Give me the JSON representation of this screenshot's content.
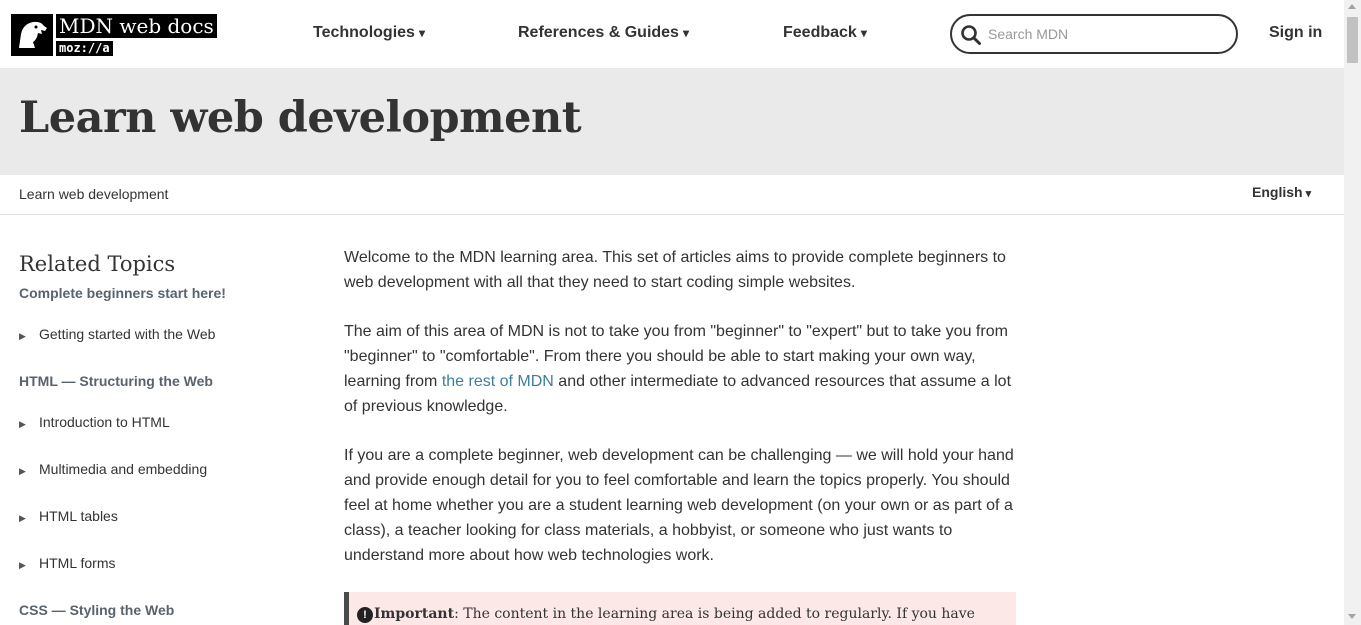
{
  "header": {
    "logo_title": "MDN web docs",
    "logo_sub": "moz://a",
    "logo_icon": "dinosaur-head-icon",
    "nav": [
      {
        "label": "Technologies"
      },
      {
        "label": "References & Guides"
      },
      {
        "label": "Feedback"
      }
    ],
    "nav_caret": "▾",
    "search_placeholder": "Search MDN",
    "search_icon": "search-icon",
    "signin_label": "Sign in"
  },
  "page": {
    "title": "Learn web development",
    "breadcrumb": "Learn web development",
    "language": "English",
    "language_caret": "▾"
  },
  "sidebar": {
    "title": "Related Topics",
    "sections": [
      {
        "heading": "Complete beginners start here!",
        "items": [
          "Getting started with the Web"
        ]
      },
      {
        "heading": "HTML — Structuring the Web",
        "items": [
          "Introduction to HTML",
          "Multimedia and embedding",
          "HTML tables",
          "HTML forms"
        ]
      },
      {
        "heading": "CSS — Styling the Web",
        "items": []
      }
    ],
    "item_marker": "▶"
  },
  "content": {
    "p1": "Welcome to the MDN learning area. This set of articles aims to provide complete beginners to web development with all that they need to start coding simple websites.",
    "p2_before": "The aim of this area of MDN is not to take you from \"beginner\" to \"expert\" but to take you from \"beginner\" to \"comfortable\". From there you should be able to start making your own way, learning from ",
    "p2_link": "the rest of MDN",
    "p2_after": " and other intermediate to advanced resources that assume a lot of previous knowledge.",
    "p3": "If you are a complete beginner, web development can be challenging — we will hold your hand and provide enough detail for you to feel comfortable and learn the topics properly. You should feel at home whether you are a student learning web development (on your own or as part of a class), a teacher looking for class materials, a hobbyist, or someone who just wants to understand more about how web technologies work.",
    "notice_label": "Important",
    "notice_text": ": The content in the learning area is being added to regularly. If you have",
    "notice_icon": "!"
  },
  "colors": {
    "title_band": "#eaeaea",
    "link": "#3d7e9a",
    "notice_bg": "#fde8e8",
    "heading_muted": "#59636e"
  }
}
